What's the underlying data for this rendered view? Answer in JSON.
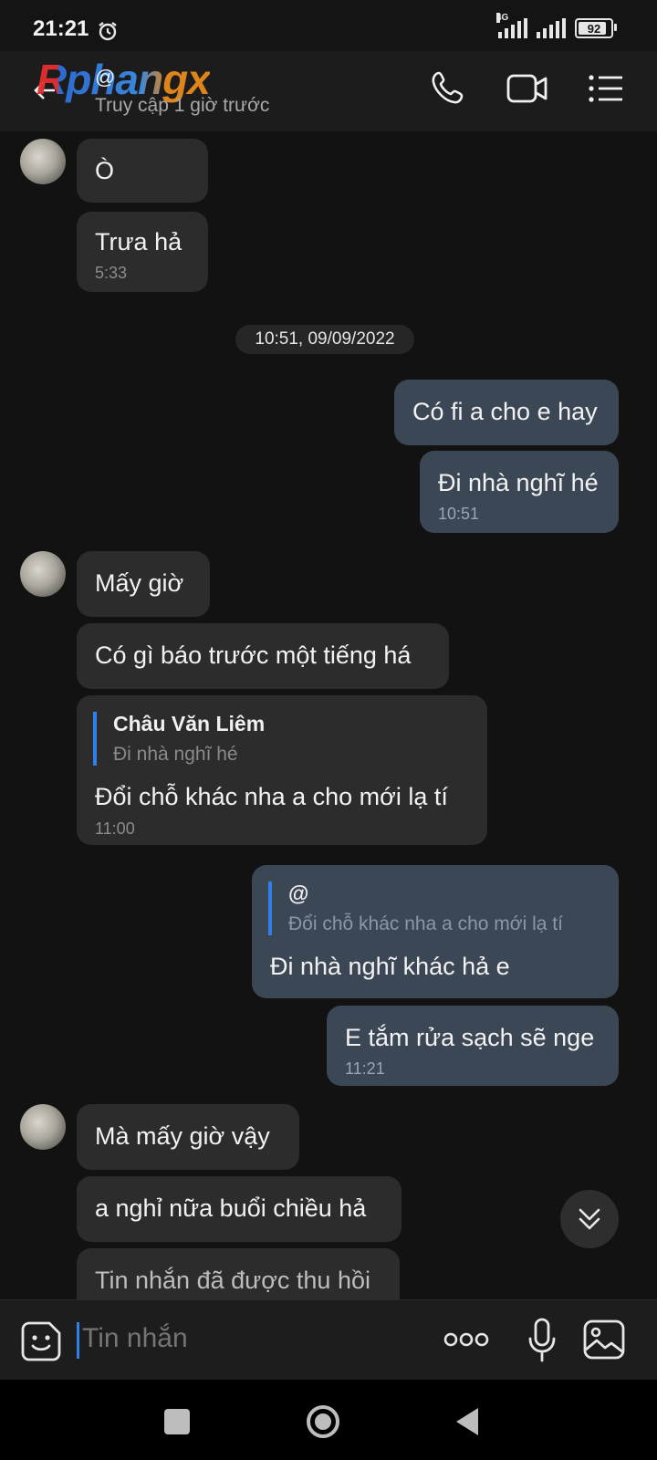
{
  "status_bar": {
    "time": "21:21",
    "network": "4G",
    "battery": "92"
  },
  "header": {
    "watermark": "Rphangx",
    "contact_name": "@",
    "last_seen": "Truy cập 1 giờ trước"
  },
  "messages": [
    {
      "side": "in",
      "text": "Ò"
    },
    {
      "side": "in",
      "text": "Trưa hả",
      "time": "5:33"
    },
    {
      "type": "date",
      "text": "10:51, 09/09/2022"
    },
    {
      "side": "out",
      "text": "Có fi a cho e hay"
    },
    {
      "side": "out",
      "text": "Đi nhà nghĩ hé",
      "time": "10:51"
    },
    {
      "side": "in",
      "text": "Mấy giờ"
    },
    {
      "side": "in",
      "text": "Có gì báo trước một tiếng há"
    },
    {
      "side": "in",
      "reply_name": "Châu Văn Liêm",
      "reply_text": "Đi nhà nghĩ hé",
      "text": "Đổi chỗ khác nha a cho mới lạ tí",
      "time": "11:00"
    },
    {
      "side": "out",
      "reply_name": "@",
      "reply_text": "Đổi chỗ khác nha a cho mới lạ tí",
      "text": "Đi nhà nghĩ khác hả e"
    },
    {
      "side": "out",
      "text": "E tắm rửa sạch sẽ nge",
      "time": "11:21"
    },
    {
      "side": "in",
      "text": "Mà mấy giờ vậy"
    },
    {
      "side": "in",
      "text": "a nghỉ nữa buổi chiều hả"
    },
    {
      "side": "in",
      "text": "Tin nhắn đã được thu hồi"
    }
  ],
  "composer": {
    "placeholder": "Tin nhắn"
  }
}
